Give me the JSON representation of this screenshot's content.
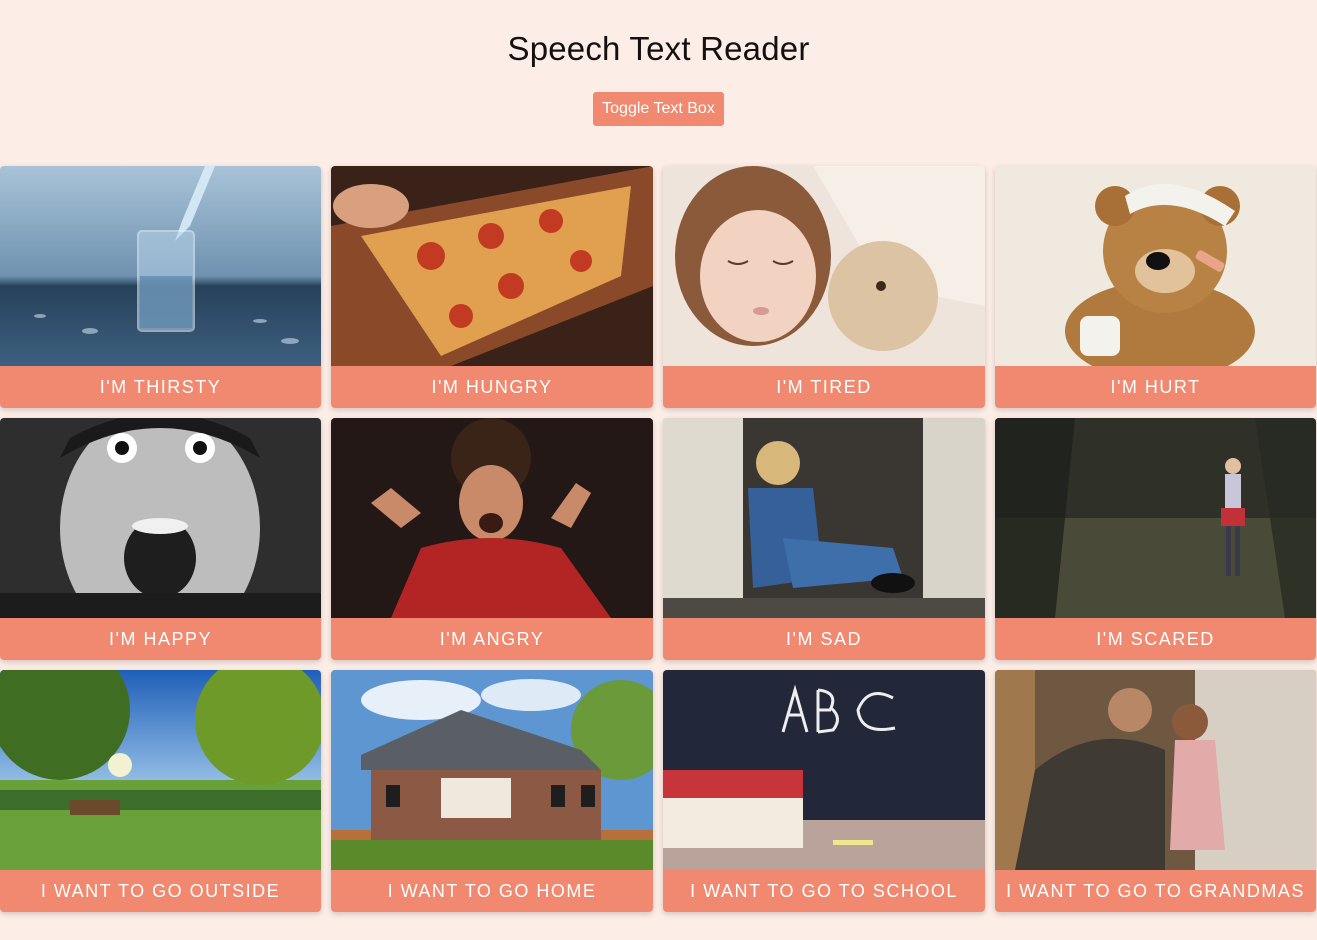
{
  "header": {
    "title": "Speech Text Reader",
    "toggle_label": "Toggle Text Box"
  },
  "cards": [
    {
      "label": "I'm Thirsty",
      "image": "glass-of-water-icon",
      "bg": "#5b7c9a"
    },
    {
      "label": "I'm Hungry",
      "image": "pizza-slice-icon",
      "bg": "#b5542a"
    },
    {
      "label": "I'm Tired",
      "image": "sleeping-child-icon",
      "bg": "#e9ddd4"
    },
    {
      "label": "I'm Hurt",
      "image": "bandaged-teddy-bear-icon",
      "bg": "#ece6d8"
    },
    {
      "label": "I'm Happy",
      "image": "excited-boy-icon",
      "bg": "#3b3b3b"
    },
    {
      "label": "I'm Angry",
      "image": "angry-child-icon",
      "bg": "#2a1d1a"
    },
    {
      "label": "I'm Sad",
      "image": "sad-child-doorway-icon",
      "bg": "#9a9890"
    },
    {
      "label": "I'm Scared",
      "image": "child-in-forest-icon",
      "bg": "#3a3a2c"
    },
    {
      "label": "I Want To Go Outside",
      "image": "park-landscape-icon",
      "bg": "#5d8a3a"
    },
    {
      "label": "I Want To Go Home",
      "image": "house-icon",
      "bg": "#7aa3c9"
    },
    {
      "label": "I Want To Go To School",
      "image": "chalkboard-books-icon",
      "bg": "#232838"
    },
    {
      "label": "I Want To Go To Grandmas",
      "image": "grandmother-child-icon",
      "bg": "#7a5f45"
    }
  ]
}
